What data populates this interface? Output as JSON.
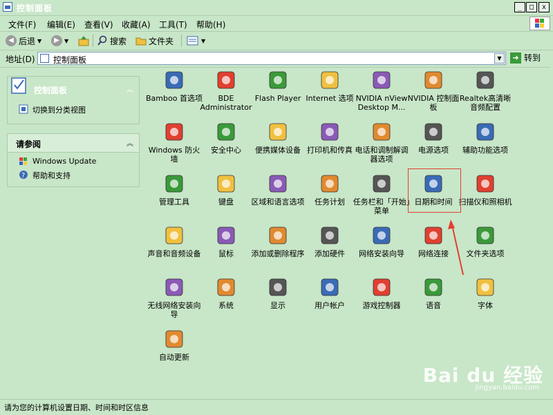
{
  "window": {
    "title": "控制面板"
  },
  "menu": [
    "文件(F)",
    "编辑(E)",
    "查看(V)",
    "收藏(A)",
    "工具(T)",
    "帮助(H)"
  ],
  "toolbar": {
    "back": "后退",
    "search": "搜索",
    "folders": "文件夹"
  },
  "address": {
    "label": "地址(D)",
    "value": "控制面板",
    "go": "转到"
  },
  "sidebar": {
    "panel1": {
      "title": "控制面板",
      "items": [
        "切换到分类视图"
      ]
    },
    "panel2": {
      "title": "请参阅",
      "items": [
        "Windows Update",
        "帮助和支持"
      ]
    }
  },
  "items": [
    [
      "Bamboo 首选项",
      "BDE Administrator",
      "Flash Player",
      "Internet 选项",
      "NVIDIA nView Desktop M...",
      "NVIDIA 控制面板",
      "Realtek高清晰音频配置"
    ],
    [
      "Windows 防火墙",
      "安全中心",
      "便携媒体设备",
      "打印机和传真",
      "电话和调制解调器选项",
      "电源选项",
      "辅助功能选项"
    ],
    [
      "管理工具",
      "键盘",
      "区域和语言选项",
      "任务计划",
      "任务栏和「开始」菜单",
      "日期和时间",
      "扫描仪和照相机"
    ],
    [
      "声音和音频设备",
      "鼠标",
      "添加或删除程序",
      "添加硬件",
      "网络安装向导",
      "网络连接",
      "文件夹选项"
    ],
    [
      "无线网络安装向导",
      "系统",
      "显示",
      "用户帐户",
      "游戏控制器",
      "语音",
      "字体"
    ],
    [
      "自动更新"
    ]
  ],
  "icons": [
    [
      "tablet-icon",
      "bde-icon",
      "flash-icon",
      "internet-options-icon",
      "nvidia-nview-icon",
      "nvidia-control-icon",
      "audio-speaker-icon"
    ],
    [
      "firewall-icon",
      "security-shield-icon",
      "media-device-icon",
      "printer-icon",
      "phone-modem-icon",
      "power-icon",
      "accessibility-icon"
    ],
    [
      "admin-tools-icon",
      "keyboard-icon",
      "globe-icon",
      "task-schedule-icon",
      "taskbar-icon",
      "clock-calendar-icon",
      "scanner-camera-icon"
    ],
    [
      "speaker-icon",
      "mouse-icon",
      "add-remove-cd-icon",
      "add-hardware-icon",
      "network-setup-icon",
      "network-connection-icon",
      "folder-options-icon"
    ],
    [
      "wireless-icon",
      "system-icon",
      "display-icon",
      "users-icon",
      "gamepad-icon",
      "speech-icon",
      "fonts-icon"
    ],
    [
      "auto-update-icon"
    ]
  ],
  "status": "请为您的计算机设置日期、时间和时区信息",
  "watermark": {
    "brand": "Bai du 经验",
    "url": "jingyan.baidu.com"
  },
  "colors": {
    "background": "#c8e6c8",
    "highlight": "#e04030",
    "accent": "#3a6bb5"
  }
}
